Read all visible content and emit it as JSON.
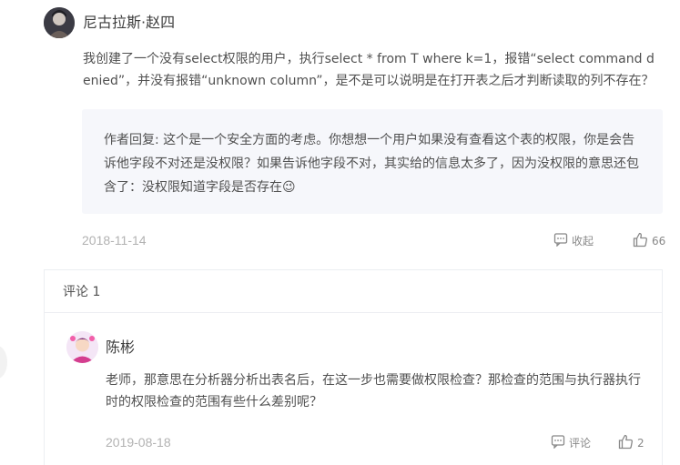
{
  "main_comment": {
    "author": "尼古拉斯·赵四",
    "body": "我创建了一个没有select权限的用户，执行select * from T where k=1，报错“select command denied”，并没有报错“unknown column”，是不是可以说明是在打开表之后才判断读取的列不存在？",
    "reply": "作者回复: 这个是一个安全方面的考虑。你想想一个用户如果没有查看这个表的权限，你是会告诉他字段不对还是没权限？如果告诉他字段不对，其实给的信息太多了，因为没权限的意思还包含了：没权限知道字段是否存在😉",
    "date": "2018-11-14",
    "collapse_label": "收起",
    "like_count": "66"
  },
  "sub_comments": {
    "title": "评论 1",
    "items": [
      {
        "author": "陈彬",
        "body": "老师，那意思在分析器分析出表名后，在这一步也需要做权限检查？那检查的范围与执行器执行时的权限检查的范围有些什么差别呢？",
        "date": "2019-08-18",
        "comment_label": "评论",
        "like_count": "2"
      }
    ]
  },
  "icons": {
    "comment": "comment-bubble-icon",
    "like": "thumbs-up-icon"
  },
  "colors": {
    "text": "#505050",
    "muted": "#b2b2b2",
    "reply_bg": "#f6f7fb",
    "border": "#eceef2"
  }
}
